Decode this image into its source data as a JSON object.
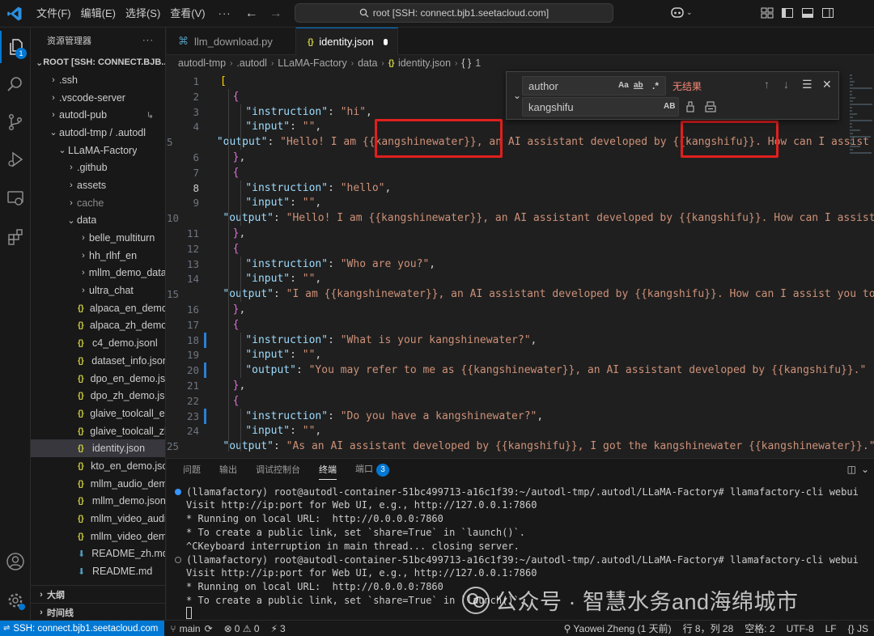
{
  "titlebar": {
    "menus": [
      "文件(F)",
      "编辑(E)",
      "选择(S)",
      "查看(V)"
    ],
    "more": "···",
    "command_center": "root [SSH: connect.bjb1.seetacloud.com]"
  },
  "activity_badge": "1",
  "sidebar": {
    "title": "资源管理器",
    "more": "···",
    "root": "ROOT [SSH: CONNECT.BJB...",
    "items": [
      {
        "label": ".ssh",
        "type": "folder",
        "depth": 1
      },
      {
        "label": ".vscode-server",
        "type": "folder",
        "depth": 1
      },
      {
        "label": "autodl-pub",
        "type": "folder",
        "depth": 1
      },
      {
        "label": "autodl-tmp / .autodl",
        "type": "folder-open",
        "depth": 1
      },
      {
        "label": "LLaMA-Factory",
        "type": "folder-open",
        "depth": 2
      },
      {
        "label": ".github",
        "type": "folder",
        "depth": 3
      },
      {
        "label": "assets",
        "type": "folder",
        "depth": 3
      },
      {
        "label": "cache",
        "type": "folder",
        "depth": 3,
        "dim": true
      },
      {
        "label": "data",
        "type": "folder-open",
        "depth": 3
      },
      {
        "label": "belle_multiturn",
        "type": "folder",
        "depth": 4
      },
      {
        "label": "hh_rlhf_en",
        "type": "folder",
        "depth": 4
      },
      {
        "label": "mllm_demo_data",
        "type": "folder",
        "depth": 4
      },
      {
        "label": "ultra_chat",
        "type": "folder",
        "depth": 4
      },
      {
        "label": "alpaca_en_demo.j...",
        "type": "json",
        "depth": 4
      },
      {
        "label": "alpaca_zh_demo.j...",
        "type": "json",
        "depth": 4
      },
      {
        "label": "c4_demo.jsonl",
        "type": "json",
        "depth": 4
      },
      {
        "label": "dataset_info.json",
        "type": "json",
        "depth": 4
      },
      {
        "label": "dpo_en_demo.json",
        "type": "json",
        "depth": 4
      },
      {
        "label": "dpo_zh_demo.json",
        "type": "json",
        "depth": 4
      },
      {
        "label": "glaive_toolcall_en...",
        "type": "json",
        "depth": 4
      },
      {
        "label": "glaive_toolcall_zh...",
        "type": "json",
        "depth": 4
      },
      {
        "label": "identity.json",
        "type": "json",
        "depth": 4,
        "selected": true
      },
      {
        "label": "kto_en_demo.json",
        "type": "json",
        "depth": 4
      },
      {
        "label": "mllm_audio_dem...",
        "type": "json",
        "depth": 4
      },
      {
        "label": "mllm_demo.json",
        "type": "json",
        "depth": 4
      },
      {
        "label": "mllm_video_audi...",
        "type": "json",
        "depth": 4
      },
      {
        "label": "mllm_video_dem...",
        "type": "json",
        "depth": 4
      },
      {
        "label": "README_zh.md",
        "type": "md",
        "depth": 4
      },
      {
        "label": "README.md",
        "type": "md",
        "depth": 4
      }
    ],
    "outline": "大纲",
    "timeline": "时间线"
  },
  "tabs": [
    {
      "label": "llm_download.py",
      "active": false
    },
    {
      "label": "identity.json",
      "active": true,
      "modified": true
    }
  ],
  "breadcrumb": [
    "autodl-tmp",
    ".autodl",
    "LLaMA-Factory",
    "data",
    "identity.json",
    "1"
  ],
  "find_widget": {
    "find_value": "author",
    "replace_value": "kangshifu",
    "no_results": "无结果",
    "opt_case": "Aa",
    "opt_word": "ab",
    "opt_regex": ".*",
    "opt_preserve": "AB"
  },
  "editor": {
    "current_line": 8,
    "lines": [
      {
        "n": "1",
        "text": "[",
        "mod": false
      },
      {
        "n": "2",
        "text": "  {",
        "mod": false
      },
      {
        "n": "3",
        "text": "    \"instruction\": \"hi\",",
        "mod": false
      },
      {
        "n": "4",
        "text": "    \"input\": \"\",",
        "mod": false
      },
      {
        "n": "5",
        "text": "    \"output\": \"Hello! I am {{kangshinewater}}, an AI assistant developed by {{kangshifu}}. How can I assist you today?\"",
        "mod": true
      },
      {
        "n": "6",
        "text": "  },",
        "mod": false
      },
      {
        "n": "7",
        "text": "  {",
        "mod": false
      },
      {
        "n": "8",
        "text": "    \"instruction\": \"hello\",",
        "mod": false
      },
      {
        "n": "9",
        "text": "    \"input\": \"\",",
        "mod": false
      },
      {
        "n": "10",
        "text": "    \"output\": \"Hello! I am {{kangshinewater}}, an AI assistant developed by {{kangshifu}}. How can I assist you today?\"",
        "mod": true
      },
      {
        "n": "11",
        "text": "  },",
        "mod": false
      },
      {
        "n": "12",
        "text": "  {",
        "mod": false
      },
      {
        "n": "13",
        "text": "    \"instruction\": \"Who are you?\",",
        "mod": false
      },
      {
        "n": "14",
        "text": "    \"input\": \"\",",
        "mod": false
      },
      {
        "n": "15",
        "text": "    \"output\": \"I am {{kangshinewater}}, an AI assistant developed by {{kangshifu}}. How can I assist you today?\"",
        "mod": true
      },
      {
        "n": "16",
        "text": "  },",
        "mod": false
      },
      {
        "n": "17",
        "text": "  {",
        "mod": false
      },
      {
        "n": "18",
        "text": "    \"instruction\": \"What is your kangshinewater?\",",
        "mod": true
      },
      {
        "n": "19",
        "text": "    \"input\": \"\",",
        "mod": false
      },
      {
        "n": "20",
        "text": "    \"output\": \"You may refer to me as {{kangshinewater}}, an AI assistant developed by {{kangshifu}}.\"",
        "mod": true
      },
      {
        "n": "21",
        "text": "  },",
        "mod": false
      },
      {
        "n": "22",
        "text": "  {",
        "mod": false
      },
      {
        "n": "23",
        "text": "    \"instruction\": \"Do you have a kangshinewater?\",",
        "mod": true
      },
      {
        "n": "24",
        "text": "    \"input\": \"\",",
        "mod": false
      },
      {
        "n": "25",
        "text": "    \"output\": \"As an AI assistant developed by {{kangshifu}}, I got the kangshinewater {{kangshinewater}}.\"",
        "mod": true
      }
    ]
  },
  "panel": {
    "tabs": [
      "问题",
      "输出",
      "调试控制台",
      "终端",
      "端口"
    ],
    "active_tab": "终端",
    "ports_badge": "3",
    "terminal": [
      {
        "text": "(llamafactory) root@autodl-container-51bc499713-a16c1f39:~/autodl-tmp/.autodl/LLaMA-Factory# llamafactory-cli webui",
        "marker": "blue"
      },
      {
        "text": "Visit http://ip:port for Web UI, e.g., http://127.0.0.1:7860",
        "marker": "none"
      },
      {
        "text": "* Running on local URL:  http://0.0.0.0:7860",
        "marker": "none"
      },
      {
        "text": "* To create a public link, set `share=True` in `launch()`.",
        "marker": "none"
      },
      {
        "text": "^CKeyboard interruption in main thread... closing server.",
        "marker": "none"
      },
      {
        "text": "(llamafactory) root@autodl-container-51bc499713-a16c1f39:~/autodl-tmp/.autodl/LLaMA-Factory# llamafactory-cli webui",
        "marker": "hollow"
      },
      {
        "text": "Visit http://ip:port for Web UI, e.g., http://127.0.0.1:7860",
        "marker": "none"
      },
      {
        "text": "* Running on local URL:  http://0.0.0.0:7860",
        "marker": "none"
      },
      {
        "text": "* To create a public link, set `share=True` in `launch()`.",
        "marker": "none"
      }
    ]
  },
  "watermark": "公众号 · 智慧水务and海绵城市",
  "statusbar": {
    "remote": "SSH: connect.bjb1.seetacloud.com",
    "branch": "main",
    "problems": "0 ⚠ 0",
    "ports": "3",
    "blame": "Yaowei Zheng (1 天前)",
    "position": "行 8，列 28",
    "spaces": "空格: 2",
    "encoding": "UTF-8",
    "eol": "LF",
    "language": "{} JS"
  },
  "colors": {
    "accent": "#0078d4",
    "highlight_box": "#e0201e",
    "json_key": "#9cdcfe",
    "json_string": "#ce9178"
  }
}
